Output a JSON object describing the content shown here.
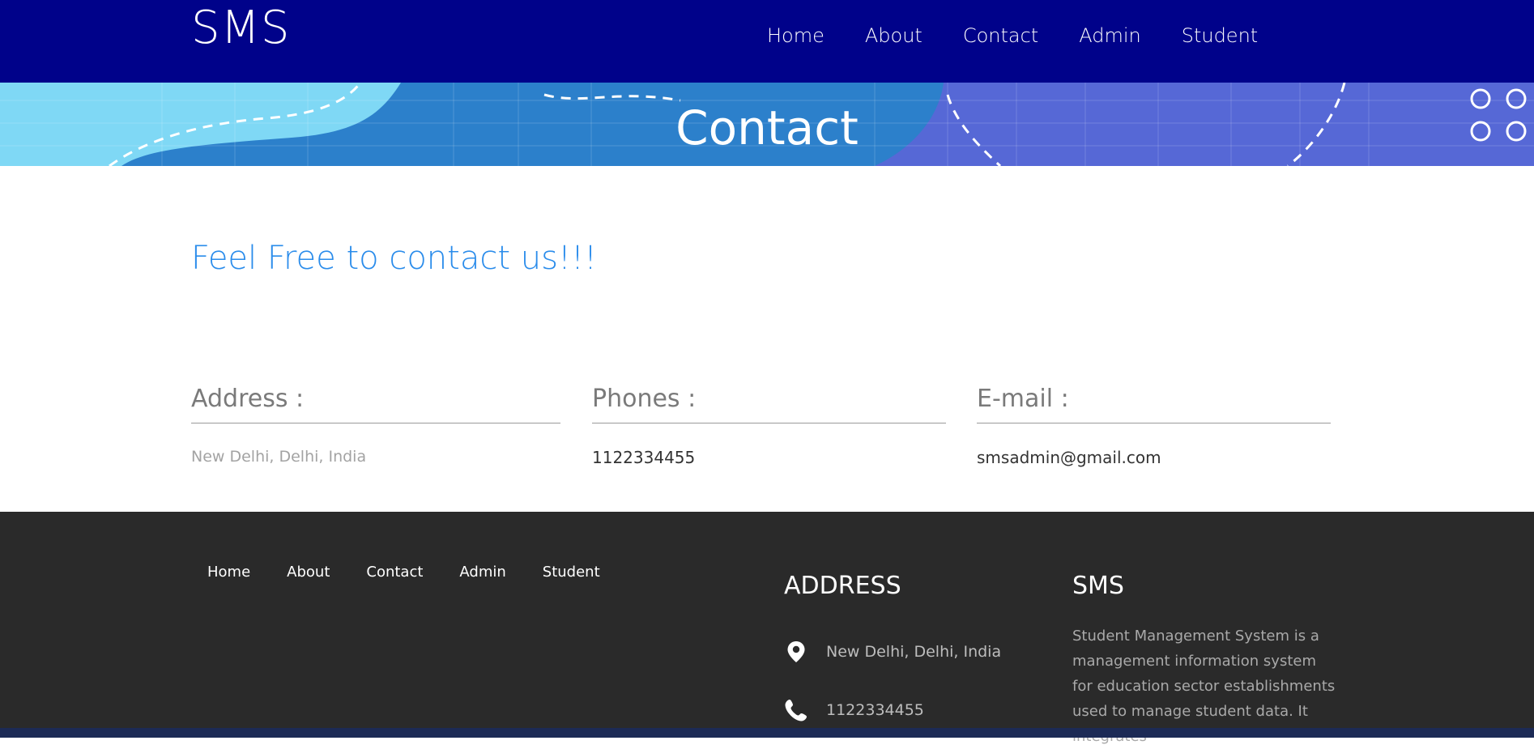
{
  "navbar": {
    "brand": "SMS",
    "links": [
      "Home",
      "About",
      "Contact",
      "Admin",
      "Student"
    ]
  },
  "banner": {
    "title": "Contact"
  },
  "main": {
    "tagline": "Feel Free to contact us!!!",
    "address": {
      "heading": "Address :",
      "value": "New Delhi, Delhi, India"
    },
    "phones": {
      "heading": "Phones :",
      "value": "1122334455"
    },
    "email": {
      "heading": "E-mail :",
      "value": "smsadmin@gmail.com"
    }
  },
  "footer": {
    "links": [
      "Home",
      "About",
      "Contact",
      "Admin",
      "Student"
    ],
    "address_heading": "ADDRESS",
    "address_value": "New Delhi, Delhi, India",
    "phone_value": "1122334455",
    "sms_heading": "SMS",
    "sms_description": "Student Management System is a management information system for education sector establishments used to manage student data. It integrates"
  },
  "icons": {
    "location": "map-pin-icon",
    "phone": "phone-icon"
  },
  "colors": {
    "navbar": "#00028a",
    "banner": "#2c80cb",
    "tagline": "#2a8ceb",
    "footer": "#2a2a2a"
  }
}
